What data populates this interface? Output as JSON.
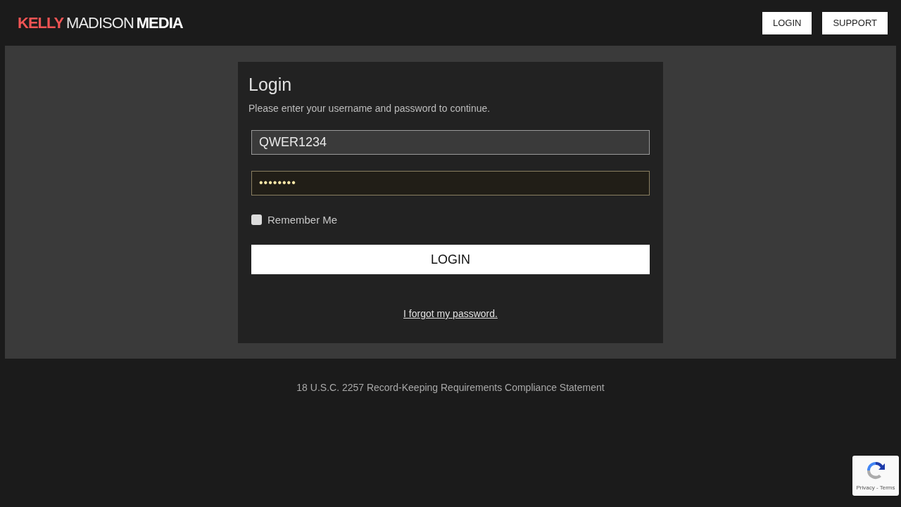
{
  "header": {
    "logo": {
      "part_1": "KELLY",
      "part_2": "MADISON",
      "part_3": "MEDIA"
    },
    "nav_buttons": [
      "LOGIN",
      "SUPPORT"
    ]
  },
  "login": {
    "title": "Login",
    "subtitle": "Please enter your username and password to continue.",
    "username": {
      "value": "QWER1234"
    },
    "password": {
      "value": "••••••••",
      "autofilled": true
    },
    "remember_me": {
      "label": "Remember Me",
      "checked": false
    },
    "submit": "LOGIN",
    "forgot_link": "I forgot my password."
  },
  "footer": {
    "link": "18 U.S.C. 2257 Record-Keeping Requirements Compliance Statement"
  },
  "recaptcha": {
    "links": "Privacy - Terms"
  }
}
